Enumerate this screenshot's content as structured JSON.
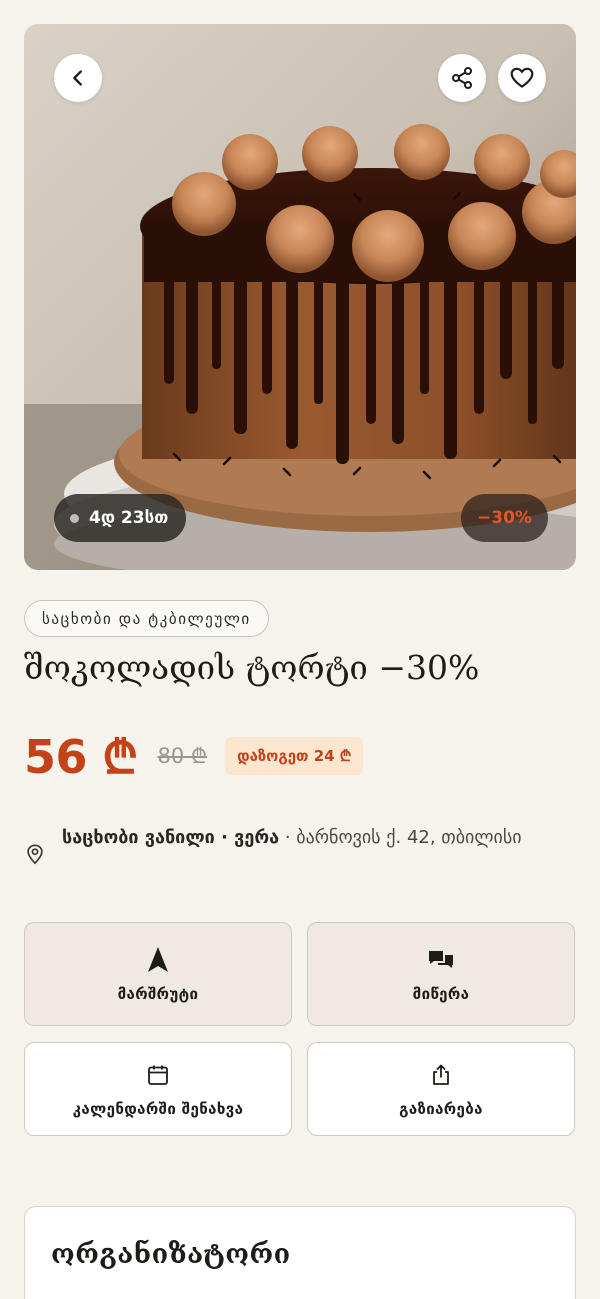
{
  "hero": {
    "image_description": "chocolate drip cake",
    "timer_text": "4დ 23სთ",
    "discount_text": "−30%"
  },
  "details": {
    "category": "საცხობი და ტკბილეული",
    "title": "შოკოლადის ტორტი −30%",
    "price_now": "56 ₾",
    "price_old": "80 ₾",
    "savings": "დაზოგეთ 24 ₾",
    "location_venue": "საცხობი ვანილი · ვერა",
    "location_address": " · ბარნოვის ქ. 42, თბილისი"
  },
  "actions": {
    "route": "მარშრუტი",
    "message": "მიწერა",
    "calendar": "კალენდარში შენახვა",
    "share": "გაზიარება"
  },
  "organizer": {
    "title": "ორგანიზატორი"
  },
  "colors": {
    "accent": "#c4421a",
    "background": "#f6f2ec",
    "savings_bg": "#fde6cf"
  },
  "icons": [
    "back-icon",
    "share-icon",
    "heart-icon",
    "pin-icon",
    "navigation-arrow-icon",
    "chat-icon",
    "calendar-icon",
    "upload-icon"
  ]
}
